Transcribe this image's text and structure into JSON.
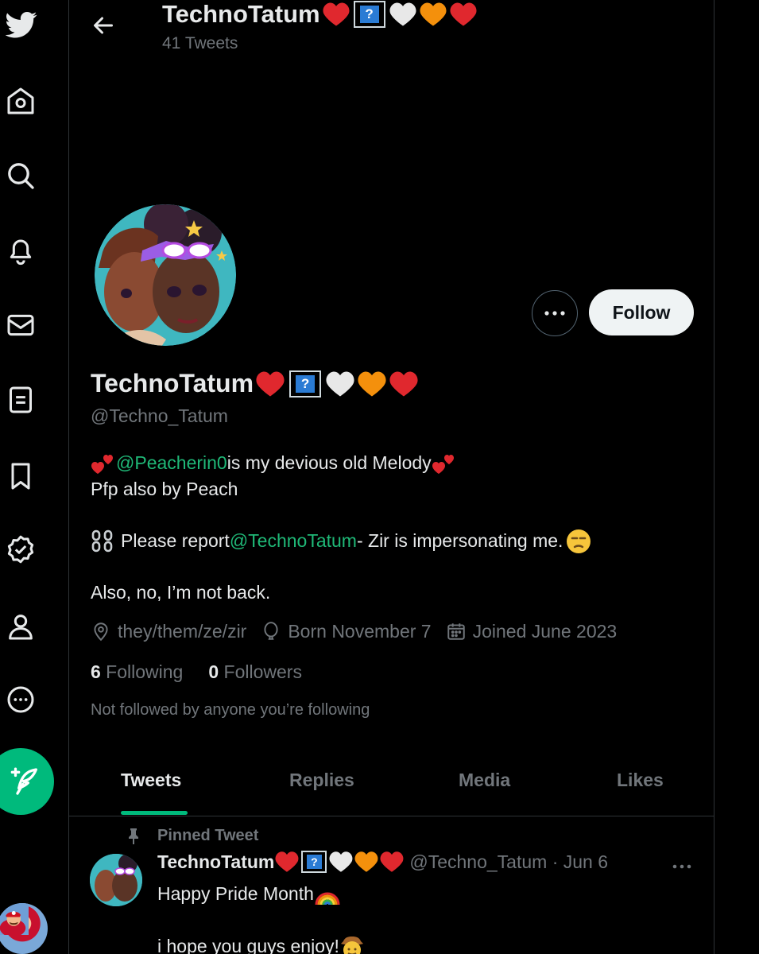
{
  "header": {
    "name": "TechnoTatum",
    "tweet_count": "41 Tweets"
  },
  "profile": {
    "name": "TechnoTatum",
    "handle": "@Techno_Tatum",
    "follow_label": "Follow",
    "bio_line1_mention": "@Peacherin0",
    "bio_line1_text": " is my devious old Melody",
    "bio_line2": "Pfp also by Peach",
    "bio_line3_prefix": "Please report ",
    "bio_line3_mention": "@TechnoTatum",
    "bio_line3_suffix": " - Zir is impersonating me. ",
    "bio_line4": "Also, no, I’m not back.",
    "pronouns": "they/them/ze/zir",
    "born": "Born November 7",
    "joined": "Joined June 2023",
    "following_count": "6",
    "following_label": " Following",
    "followers_count": "0",
    "followers_label": " Followers",
    "not_followed": "Not followed by anyone you’re following"
  },
  "tabs": [
    "Tweets",
    "Replies",
    "Media",
    "Likes"
  ],
  "pinned_tweet": {
    "pinned_label": "Pinned Tweet",
    "name": "TechnoTatum",
    "handle_date": "@Techno_Tatum · Jun 6",
    "text_line1": "Happy Pride Month ",
    "text_line2": "i hope you guys enjoy! "
  },
  "colors": {
    "accent_green": "#00ba7c",
    "link_green": "#1fb877",
    "muted": "#71767b",
    "heart_red": "#e0282e",
    "heart_orange": "#f4900c",
    "heart_white": "#e8e8e8"
  }
}
